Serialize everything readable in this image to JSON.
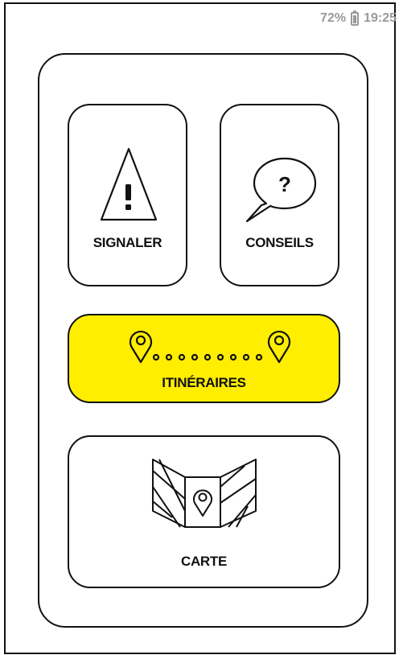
{
  "status_bar": {
    "battery_percent": "72%",
    "battery_level": 0.72,
    "time": "19:25",
    "icon": "battery-icon",
    "color": "#9a9a9a"
  },
  "menu": {
    "signaler": {
      "label": "SIGNALER",
      "icon": "warning-triangle-icon"
    },
    "conseils": {
      "label": "CONSEILS",
      "icon": "question-speech-bubble-icon"
    },
    "itineraires": {
      "label": "ITINÉRAIRES",
      "icon": "route-pins-icon",
      "background": "#ffee00"
    },
    "carte": {
      "label": "CARTE",
      "icon": "folded-map-pin-icon"
    }
  }
}
